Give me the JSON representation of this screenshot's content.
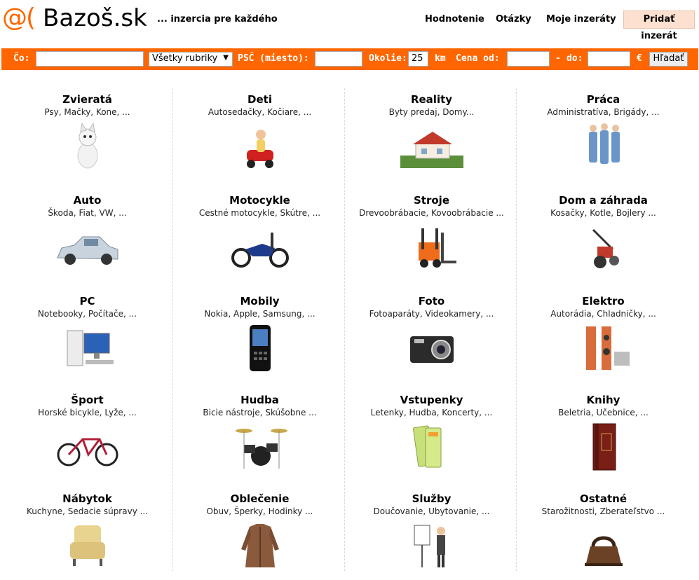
{
  "header": {
    "logo_mark": "@(",
    "logo_text": "Bazoš.sk",
    "tagline": "... inzercia pre každého",
    "nav": [
      "Hodnotenie",
      "Otázky",
      "Moje inzeráty"
    ],
    "add_button": "Pridať inzerát"
  },
  "search": {
    "what_label": "Čo:",
    "what_value": "",
    "category_value": "Všetky rubriky",
    "zip_label": "PSČ (miesto):",
    "zip_value": "",
    "radius_label": "Okolie:",
    "radius_value": "25",
    "radius_unit": "km",
    "price_from_label": "Cena od:",
    "price_from_value": "",
    "dash": "-",
    "price_to_label": "do:",
    "price_to_value": "",
    "currency": "€",
    "button": "Hľadať"
  },
  "categories": [
    {
      "title": "Zvieratá",
      "sub": "Psy, Mačky, Kone, ...",
      "icon": "cat-icon"
    },
    {
      "title": "Deti",
      "sub": "Autosedačky, Kočiare, ...",
      "icon": "child-car-icon"
    },
    {
      "title": "Reality",
      "sub": "Byty predaj, Domy...",
      "icon": "house-icon"
    },
    {
      "title": "Práca",
      "sub": "Administratíva, Brigády, ...",
      "icon": "workers-icon"
    },
    {
      "title": "Auto",
      "sub": "Škoda, Fiat, VW, ...",
      "icon": "car-icon"
    },
    {
      "title": "Motocykle",
      "sub": "Cestné motocykle, Skútre, ...",
      "icon": "motorcycle-icon"
    },
    {
      "title": "Stroje",
      "sub": "Drevoobrábacie, Kovoobrábacie ...",
      "icon": "forklift-icon"
    },
    {
      "title": "Dom a záhrada",
      "sub": "Kosačky, Kotle, Bojlery ...",
      "icon": "tiller-icon"
    },
    {
      "title": "PC",
      "sub": "Notebooky, Počítače, ...",
      "icon": "computer-icon"
    },
    {
      "title": "Mobily",
      "sub": "Nokia, Apple, Samsung, ...",
      "icon": "phone-icon"
    },
    {
      "title": "Foto",
      "sub": "Fotoaparáty, Videokamery, ...",
      "icon": "camera-icon"
    },
    {
      "title": "Elektro",
      "sub": "Autorádia, Chladničky, ...",
      "icon": "speakers-icon"
    },
    {
      "title": "Šport",
      "sub": "Horské bicykle, Lyže, ...",
      "icon": "bicycle-icon"
    },
    {
      "title": "Hudba",
      "sub": "Bicie nástroje, Skúšobne ...",
      "icon": "drums-icon"
    },
    {
      "title": "Vstupenky",
      "sub": "Letenky, Hudba, Koncerty, ...",
      "icon": "tickets-icon"
    },
    {
      "title": "Knihy",
      "sub": "Beletria, Učebnice, ...",
      "icon": "book-icon"
    },
    {
      "title": "Nábytok",
      "sub": "Kuchyne, Sedacie súpravy ...",
      "icon": "armchair-icon"
    },
    {
      "title": "Oblečenie",
      "sub": "Obuv, Šperky, Hodinky ...",
      "icon": "coat-icon"
    },
    {
      "title": "Služby",
      "sub": "Doučovanie, Ubytovanie, ...",
      "icon": "presenter-icon"
    },
    {
      "title": "Ostatné",
      "sub": "Starožitnosti, Zberateľstvo ...",
      "icon": "antique-iron-icon"
    }
  ],
  "colors": {
    "accent": "#ff6600",
    "add_button_bg": "#fde0cf"
  }
}
